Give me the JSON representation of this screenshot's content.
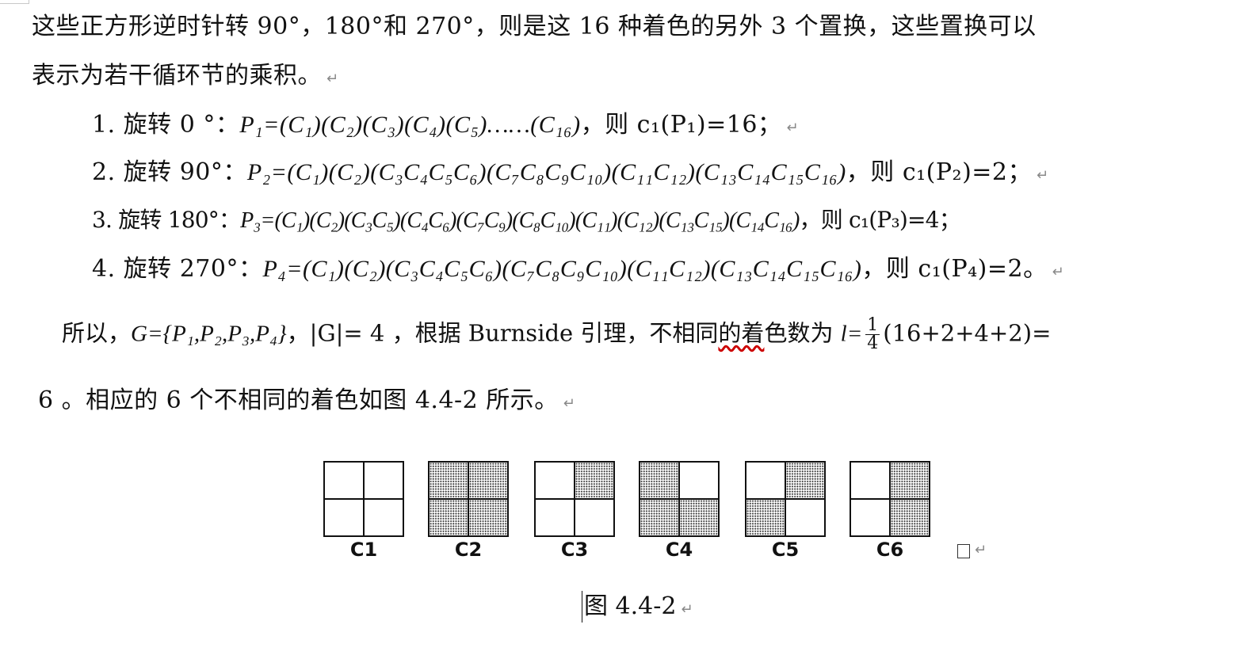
{
  "para1": {
    "line1": "这些正方形逆时针转 90°，180°和 270°，则是这 16 种着色的另外 3 个置换，这些置换可以",
    "line2": "表示为若干循环节的乘积。"
  },
  "items": [
    {
      "lead": "1.  旋转 0 °：",
      "formula": "P₁=(C₁)(C₂)(C₃)(C₄)(C₅)……(C₁₆)",
      "result": "，则 c₁(P₁)=16；"
    },
    {
      "lead": "2.  旋转 90°：",
      "formula": "P₂=(C₁)(C₂)(C₃C₄C₅C₆)(C₇C₈C₉C₁₀)(C₁₁C₁₂)(C₁₃C₁₄C₁₅C₁₆)",
      "result": "，则 c₁(P₂)=2；"
    },
    {
      "lead": "3.  旋转 180°：",
      "formula": "P₃=(C₁)(C₂)(C₃C₅)(C₄C₆)(C₇C₉)(C₈C₁₀)(C₁₁)(C₁₂)(C₁₃C₁₅)(C₁₄C₁₆)",
      "result": "，则 c₁(P₃)=4；"
    },
    {
      "lead": "4.  旋转 270°：",
      "formula": "P₄=(C₁)(C₂)(C₃C₄C₅C₆)(C₇C₈C₉C₁₀)(C₁₁C₁₂)(C₁₃C₁₄C₁₅C₁₆)",
      "result": "，则 c₁(P₄)=2。"
    }
  ],
  "para2": {
    "start": "所以，",
    "group": "G={P₁,P₂,P₃,P₄}",
    "order": "，|G|= 4 ，根据 Burnside 引理，不相同",
    "underlined": "的着",
    "rest": "色数为 ",
    "l_eq": "l=",
    "frac_num": "1",
    "frac_den": "4",
    "sum": "(16+2+4+2)=",
    "line2": "6 。相应的 6 个不相同的着色如图 4.4-2 所示。"
  },
  "figure": {
    "squares": [
      {
        "label": "C1",
        "tl": false,
        "tr": false,
        "bl": false,
        "br": false
      },
      {
        "label": "C2",
        "tl": true,
        "tr": true,
        "bl": true,
        "br": true
      },
      {
        "label": "C3",
        "tl": false,
        "tr": true,
        "bl": false,
        "br": false
      },
      {
        "label": "C4",
        "tl": true,
        "tr": false,
        "bl": true,
        "br": true
      },
      {
        "label": "C5",
        "tl": false,
        "tr": true,
        "bl": true,
        "br": false
      },
      {
        "label": "C6",
        "tl": false,
        "tr": true,
        "bl": false,
        "br": true
      }
    ],
    "caption": "图 4.4-2"
  },
  "paragraph_mark": "↵"
}
